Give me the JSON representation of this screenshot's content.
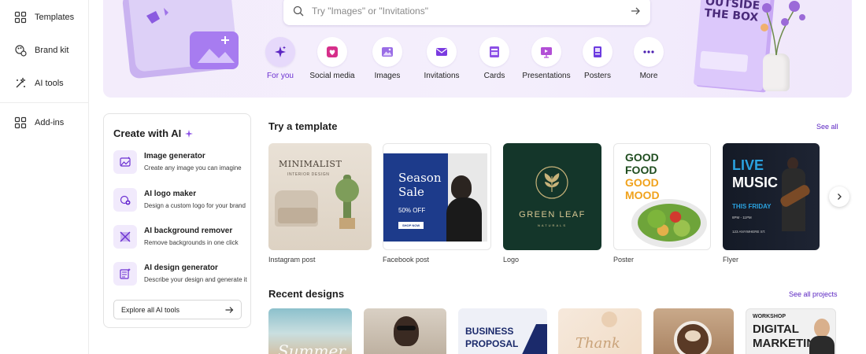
{
  "sidebar": {
    "items": [
      {
        "label": "Templates",
        "icon": "templates-icon"
      },
      {
        "label": "Brand kit",
        "icon": "brand-kit-icon"
      },
      {
        "label": "AI tools",
        "icon": "ai-tools-icon"
      },
      {
        "label": "Add-ins",
        "icon": "add-ins-icon"
      }
    ]
  },
  "hero": {
    "search_placeholder": "Try \"Images\" or \"Invitations\"",
    "poster_text_1": "OUTSIDE",
    "poster_text_2": "THE BOX",
    "categories": [
      {
        "label": "For you",
        "icon": "sparkle-icon",
        "active": true
      },
      {
        "label": "Social media",
        "icon": "heart-icon"
      },
      {
        "label": "Images",
        "icon": "image-icon"
      },
      {
        "label": "Invitations",
        "icon": "envelope-icon"
      },
      {
        "label": "Cards",
        "icon": "card-icon"
      },
      {
        "label": "Presentations",
        "icon": "presentation-icon"
      },
      {
        "label": "Posters",
        "icon": "poster-icon"
      },
      {
        "label": "More",
        "icon": "more-icon"
      }
    ]
  },
  "ai_panel": {
    "title": "Create with AI",
    "items": [
      {
        "title": "Image generator",
        "desc": "Create any image you can imagine"
      },
      {
        "title": "AI logo maker",
        "desc": "Design a custom logo for your brand"
      },
      {
        "title": "AI background remover",
        "desc": "Remove backgrounds in one click"
      },
      {
        "title": "AI design generator",
        "desc": "Describe your design and generate it"
      }
    ],
    "explore_label": "Explore all AI tools"
  },
  "templates": {
    "title": "Try a template",
    "see_all": "See all",
    "items": [
      {
        "label": "Instagram post",
        "text_1": "MINIMALIST",
        "text_2": "INTERIOR DESIGN"
      },
      {
        "label": "Facebook post",
        "text_1": "Season",
        "text_2": "Sale",
        "text_3": "50% OFF",
        "text_4": "SHOP NOW"
      },
      {
        "label": "Logo",
        "text_1": "GREEN LEAF",
        "text_2": "NATURALS"
      },
      {
        "label": "Poster",
        "text_1": "GOOD",
        "text_2": "FOOD",
        "text_3": "GOOD",
        "text_4": "MOOD"
      },
      {
        "label": "Flyer",
        "text_1": "LIVE",
        "text_2": "MUSIC",
        "text_3": "THIS FRIDAY",
        "text_4": "8PM - 11PM",
        "text_5": "123 ANYWHERE ST."
      }
    ]
  },
  "recent": {
    "title": "Recent designs",
    "see_all": "See all projects",
    "items": [
      {
        "text": "Summer"
      },
      {
        "text": ""
      },
      {
        "text_1": "BUSINESS",
        "text_2": "PROPOSAL"
      },
      {
        "text": "Thank"
      },
      {
        "text": ""
      },
      {
        "text_1": "WORKSHOP",
        "text_2": "DIGITAL",
        "text_3": "MARKETING"
      }
    ]
  },
  "colors": {
    "accent": "#6b2fd1",
    "link": "#5b25c2",
    "hero_bg": "#f3ecfb"
  }
}
